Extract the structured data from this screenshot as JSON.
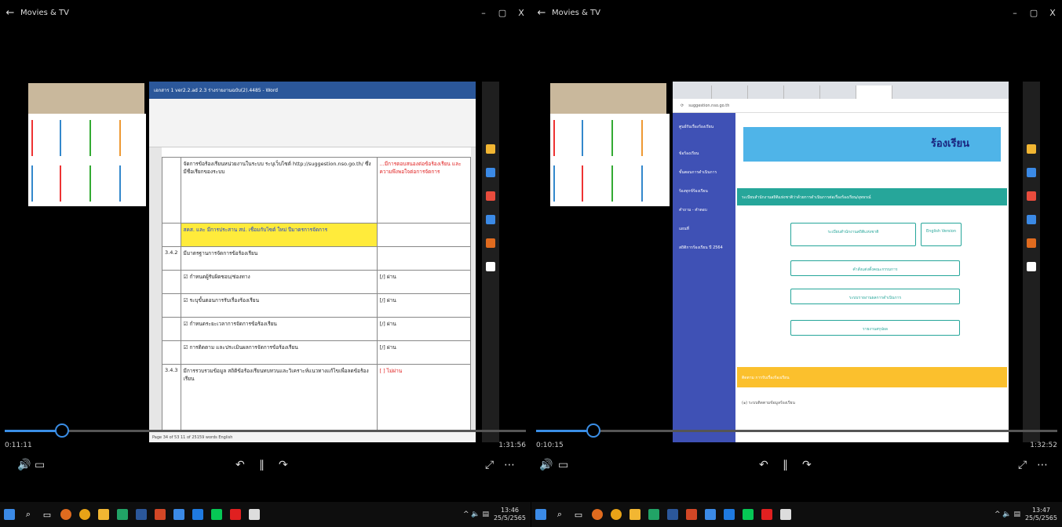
{
  "left_window": {
    "title": "Movies & TV",
    "time_elapsed": "0:11:11",
    "time_remaining": "1:31:56",
    "progress": 0.11,
    "word_doc": {
      "title": "เอกสาร 1 ver2.2.ad 2.3 ร่างรายงานฉบับ(2).4485 - Word",
      "status": "Page 34 of 53  11 of 25159 words  English",
      "rows": [
        {
          "num": "",
          "text": "จัดการข้อร้องเรียนหน่วยงานในระบบ ระบุเว็บไซต์ http://suggestion.nso.go.th/ ซึ่งมีชื่อเรียกของระบบ",
          "note": "...มีการตอบสนองต่อข้อร้องเรียน และ ความพึงพอใจต่อการจัดการ"
        },
        {
          "num": "",
          "text": "สคส. และ มีการประสาน สป. เชื่อมกับไซด์ ใหม่ ปีมาตรการจัดการ",
          "note": ""
        },
        {
          "num": "3.4.2",
          "text": "มีมาตรฐานการจัดการข้อร้องเรียน",
          "note": ""
        },
        {
          "num": "",
          "text": "☑ กำหนดผู้รับผิดชอบ/ช่องทาง",
          "note": "[/] ผ่าน"
        },
        {
          "num": "",
          "text": "☑ ระบุขั้นตอนการรับเรื่องร้องเรียน",
          "note": "[/] ผ่าน"
        },
        {
          "num": "",
          "text": "☑ กำหนดระยะเวลาการจัดการข้อร้องเรียน",
          "note": "[/] ผ่าน"
        },
        {
          "num": "",
          "text": "☑ การติดตาม และประเมินผลการจัดการข้อร้องเรียน",
          "note": "[/] ผ่าน"
        },
        {
          "num": "3.4.3",
          "text": "มีการรวบรวมข้อมูล สถิติข้อร้องเรียนทบทวนและวิเคราะห์แนวทางแก้ไขเพื่อลดข้อร้องเรียน",
          "note": "[ ] ไม่ผ่าน"
        }
      ]
    }
  },
  "right_window": {
    "title": "Movies & TV",
    "time_elapsed": "0:10:15",
    "time_remaining": "1:32:52",
    "progress": 0.11,
    "browser": {
      "url": "suggestion.nso.go.th",
      "site_title": "ร้องเรียน",
      "sidebar": [
        "ศูนย์รับเรื่องร้องเรียน",
        "ข้อร้องเรียน",
        "ขั้นตอนการดำเนินการ",
        "ร้องทุกข์ร้องเรียน",
        "คำถาม - คำตอบ",
        "แผนที่",
        "สถิติการร้องเรียน ปี 2564"
      ],
      "header_bar": "ระเบียบสำนักงานสถิติแห่งชาติว่าด้วยการดำเนินการต่อเรื่องร้องเรียน/อุทธรณ์",
      "buttons": [
        "ระเบียบสำนักงานสถิติแห่งชาติ",
        "English Version",
        "คำสั่งแต่งตั้งคณะกรรมการ",
        "ระบบรายงานผลการดำเนินการ",
        "รายงานสรุปผล"
      ],
      "yellow_bar": "ติดตาม การรับเรื่องร้องเรียน",
      "footer_text": "(๑) ระบบติดตามข้อมูลร้องเรียน"
    }
  },
  "taskbar_left": {
    "time": "13:46",
    "date": "25/5/2565"
  },
  "taskbar_right": {
    "time": "13:47",
    "date": "25/5/2565"
  }
}
